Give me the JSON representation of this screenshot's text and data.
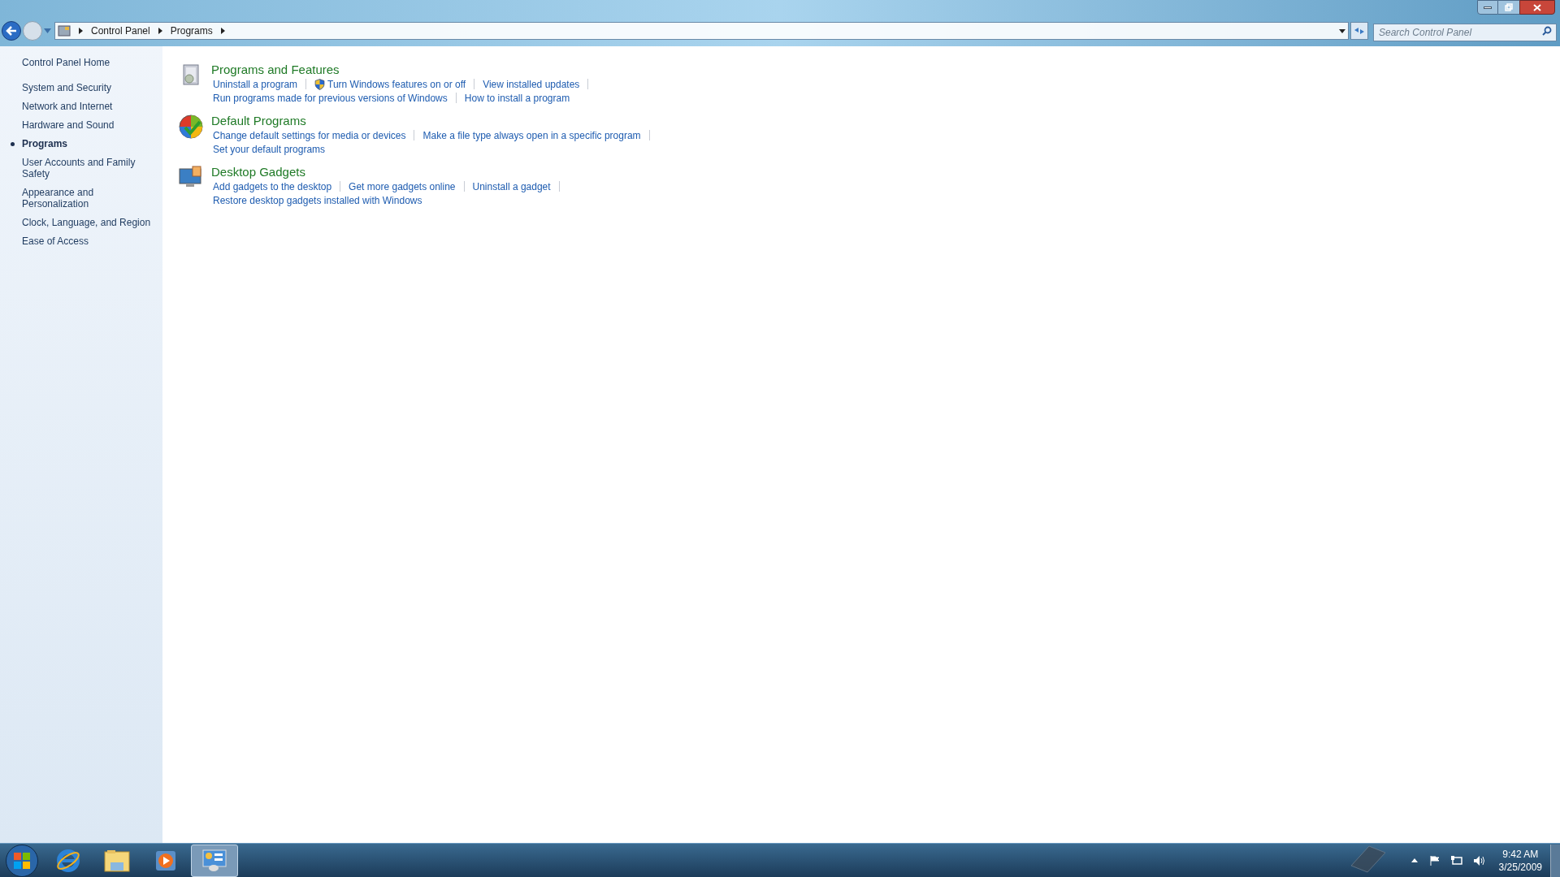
{
  "address_bar": {
    "breadcrumb": [
      "Control Panel",
      "Programs"
    ]
  },
  "search": {
    "placeholder": "Search Control Panel"
  },
  "sidebar": {
    "items": [
      {
        "label": "Control Panel Home",
        "selected": false
      },
      {
        "label": "System and Security",
        "selected": false
      },
      {
        "label": "Network and Internet",
        "selected": false
      },
      {
        "label": "Hardware and Sound",
        "selected": false
      },
      {
        "label": "Programs",
        "selected": true
      },
      {
        "label": "User Accounts and Family Safety",
        "selected": false
      },
      {
        "label": "Appearance and Personalization",
        "selected": false
      },
      {
        "label": "Clock, Language, and Region",
        "selected": false
      },
      {
        "label": "Ease of Access",
        "selected": false
      }
    ]
  },
  "sections": [
    {
      "kind": "programs",
      "title": "Programs and Features",
      "lines": [
        [
          {
            "text": "Uninstall a program",
            "kind": "plain"
          },
          {
            "text": "Turn Windows features on or off",
            "kind": "shield"
          },
          {
            "text": "View installed updates",
            "kind": "plain"
          }
        ],
        [
          {
            "text": "Run programs made for previous versions of Windows",
            "kind": "plain"
          },
          {
            "text": "How to install a program",
            "kind": "plain"
          }
        ]
      ]
    },
    {
      "kind": "defaults",
      "title": "Default Programs",
      "lines": [
        [
          {
            "text": "Change default settings for media or devices",
            "kind": "plain"
          },
          {
            "text": "Make a file type always open in a specific program",
            "kind": "plain"
          }
        ],
        [
          {
            "text": "Set your default programs",
            "kind": "plain"
          }
        ]
      ]
    },
    {
      "kind": "gadgets",
      "title": "Desktop Gadgets",
      "lines": [
        [
          {
            "text": "Add gadgets to the desktop",
            "kind": "plain"
          },
          {
            "text": "Get more gadgets online",
            "kind": "plain"
          },
          {
            "text": "Uninstall a gadget",
            "kind": "plain"
          }
        ],
        [
          {
            "text": "Restore desktop gadgets installed with Windows",
            "kind": "plain"
          }
        ]
      ]
    }
  ],
  "taskbar": {
    "apps": [
      {
        "kind": "browser",
        "selected": false
      },
      {
        "kind": "folder",
        "selected": false
      },
      {
        "kind": "media",
        "selected": false
      },
      {
        "kind": "control-panel",
        "selected": true
      }
    ],
    "clock": {
      "time": "9:42 AM",
      "date": "3/25/2009"
    }
  }
}
